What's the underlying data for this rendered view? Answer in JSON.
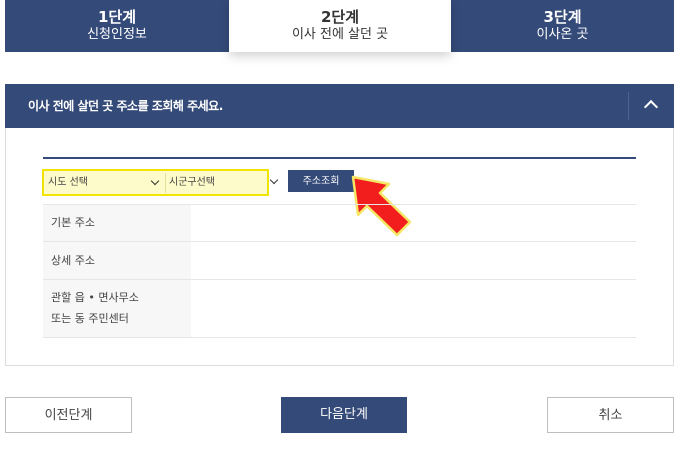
{
  "steps": [
    {
      "num": "1단계",
      "label": "신청인정보"
    },
    {
      "num": "2단계",
      "label": "이사 전에 살던 곳"
    },
    {
      "num": "3단계",
      "label": "이사온 곳"
    }
  ],
  "panel": {
    "title": "이사 전에 살던 곳 주소를 조회해 주세요."
  },
  "form": {
    "sido_select": "시도 선택",
    "sigungu_select": "시군구선택",
    "search_button": "주소조회",
    "rows": [
      {
        "label_lines": [
          "기본 주소"
        ],
        "value": ""
      },
      {
        "label_lines": [
          "상세 주소"
        ],
        "value": ""
      },
      {
        "label_lines": [
          "관할 읍 • 면사무소",
          "또는 동 주민센터"
        ],
        "value": ""
      }
    ]
  },
  "footer": {
    "prev": "이전단계",
    "next": "다음단계",
    "cancel": "취소"
  }
}
